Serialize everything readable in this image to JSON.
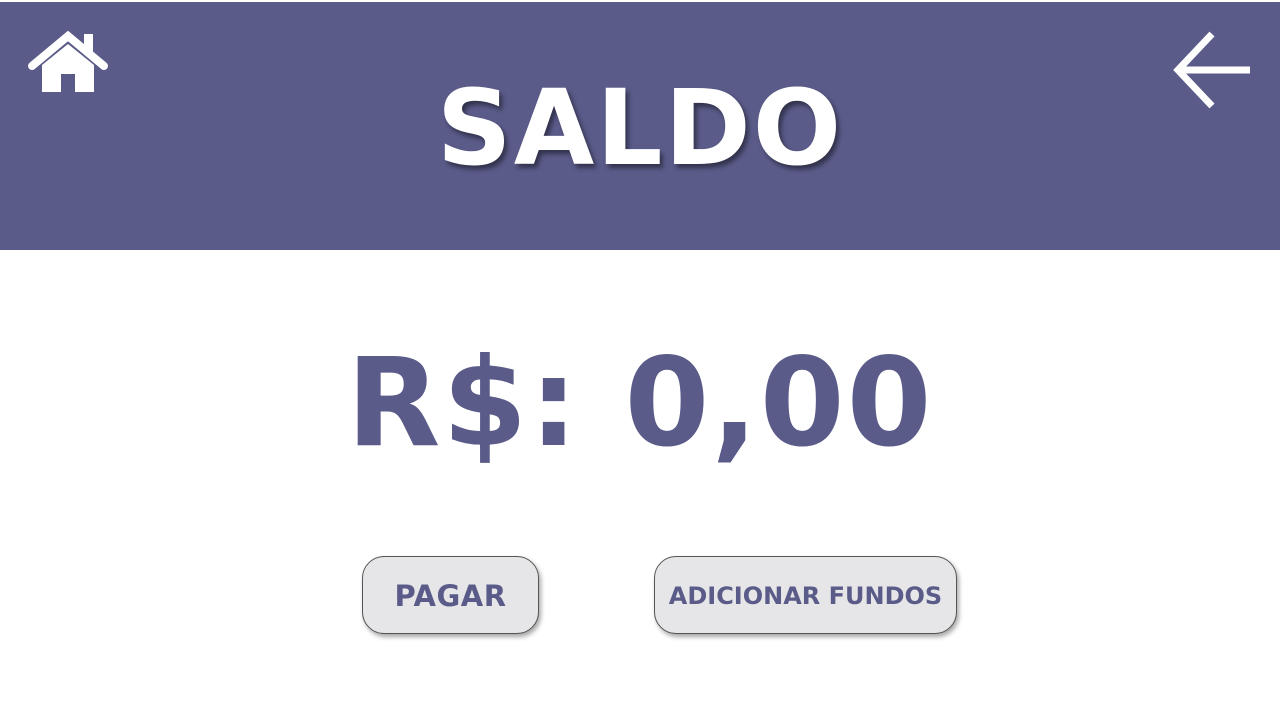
{
  "header": {
    "title": "SALDO",
    "home_icon": "home-icon",
    "back_icon": "arrow-left-icon",
    "background_color": "#5a5b89"
  },
  "balance": {
    "text": "R$: 0,00"
  },
  "actions": {
    "pay_label": "PAGAR",
    "add_funds_label": "ADICIONAR FUNDOS"
  },
  "colors": {
    "accent": "#5a5b89",
    "button_bg": "#e6e6e8",
    "text_on_header": "#ffffff"
  }
}
